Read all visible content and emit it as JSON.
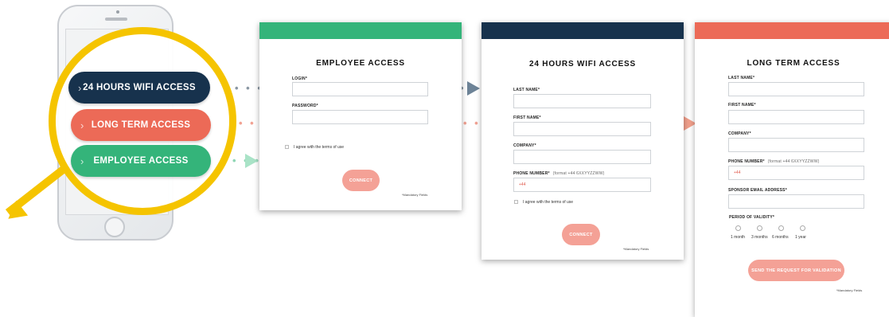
{
  "colors": {
    "employee": "#34b47a",
    "wifi": "#17324d",
    "long_term": "#ec6a57",
    "magnifier": "#f5c400",
    "connect_button": "#f4a196"
  },
  "phone": {
    "buttons": {
      "wifi": "24 HOURS WIFI ACCESS",
      "long_term": "LONG TERM ACCESS",
      "employee": "EMPLOYEE ACCESS"
    },
    "chevron": "›"
  },
  "connectors": {
    "dots": "• • •"
  },
  "employee_form": {
    "title": "EMPLOYEE ACCESS",
    "login_label": "LOGIN*",
    "password_label": "PASSWORD*",
    "terms": "I agree with the terms of use",
    "connect": "CONNECT",
    "mandatory": "*Mandatory Fields"
  },
  "wifi_form": {
    "title": "24 HOURS WIFI ACCESS",
    "last_name_label": "LAST NAME*",
    "first_name_label": "FIRST NAME*",
    "company_label": "COMPANY*",
    "phone_label": "PHONE NUMBER*",
    "phone_hint": "(format +44 6XXYYZZWW)",
    "phone_prefix": "+44",
    "terms": "I agree with the terms of use",
    "connect": "CONNECT",
    "mandatory": "*Mandatory Fields"
  },
  "long_form": {
    "title": "LONG TERM ACCESS",
    "last_name_label": "LAST NAME*",
    "first_name_label": "FIRST NAME*",
    "company_label": "COMPANY*",
    "phone_label": "PHONE NUMBER*",
    "phone_hint": "(format +44 6XXYYZZWW)",
    "phone_prefix": "+44",
    "sponsor_label": "SPONSOR EMAIL ADDRESS*",
    "validity_label": "PERIOD OF VALIDITY*",
    "validity_options": [
      "1 month",
      "3 months",
      "6 months",
      "1 year"
    ],
    "submit": "SEND THE REQUEST FOR VALIDATION",
    "mandatory": "*Mandatory Fields"
  }
}
